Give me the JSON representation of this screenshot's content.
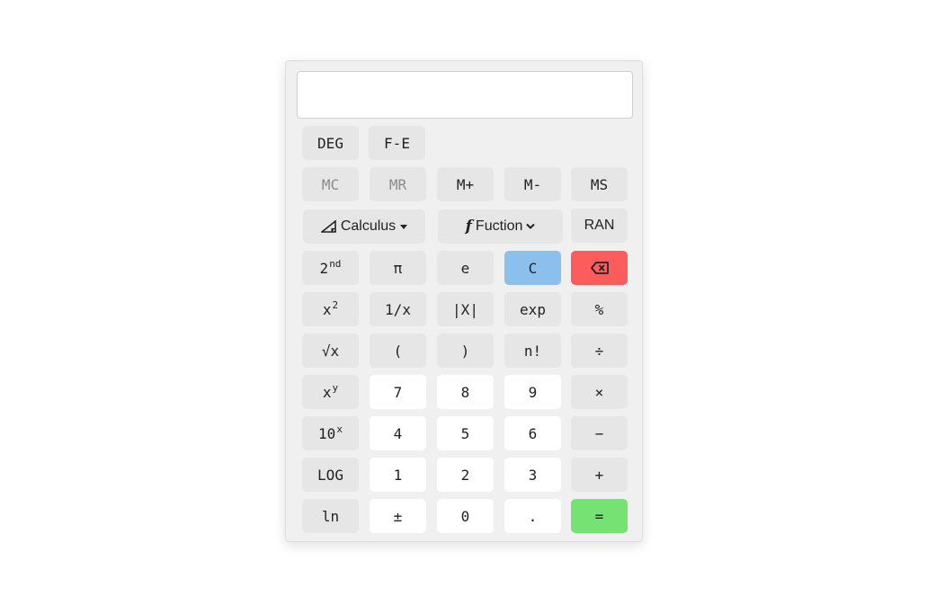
{
  "display": {
    "value": ""
  },
  "mode_row": {
    "deg": "DEG",
    "fe": "F-E"
  },
  "memory_row": {
    "mc": "MC",
    "mr": "MR",
    "mplus": "M+",
    "mminus": "M-",
    "ms": "MS"
  },
  "func_row": {
    "calculus": "Calculus",
    "function": "Fuction",
    "ran": "RAN"
  },
  "row1": {
    "second_base": "2",
    "second_sup": "nd",
    "pi": "π",
    "e": "e",
    "clear": "C"
  },
  "row2": {
    "square_base": "x",
    "square_sup": "2",
    "reciprocal": "1/x",
    "abs": "|X|",
    "exp": "exp",
    "percent": "%"
  },
  "row3": {
    "sqrt": "√x",
    "lparen": "(",
    "rparen": ")",
    "factorial": "n!",
    "divide": "÷"
  },
  "row4": {
    "power_base": "x",
    "power_sup": "y",
    "seven": "7",
    "eight": "8",
    "nine": "9",
    "multiply": "×"
  },
  "row5": {
    "tenpow_base": "10",
    "tenpow_sup": "x",
    "four": "4",
    "five": "5",
    "six": "6",
    "minus": "−"
  },
  "row6": {
    "log": "LOG",
    "one": "1",
    "two": "2",
    "three": "3",
    "plus": "+"
  },
  "row7": {
    "ln": "ln",
    "negate": "±",
    "zero": "0",
    "dot": ".",
    "equals": "="
  },
  "icons": {
    "calculus": "triangle-ruler-icon",
    "function": "function-f-icon",
    "backspace": "backspace-icon",
    "dropdown": "caret-down-icon",
    "chevron": "chevron-down-icon"
  },
  "colors": {
    "clear": "#8cc0ec",
    "backspace": "#fd5c5c",
    "equals": "#74e373",
    "key": "#e6e6e6",
    "digit": "#ffffff"
  }
}
